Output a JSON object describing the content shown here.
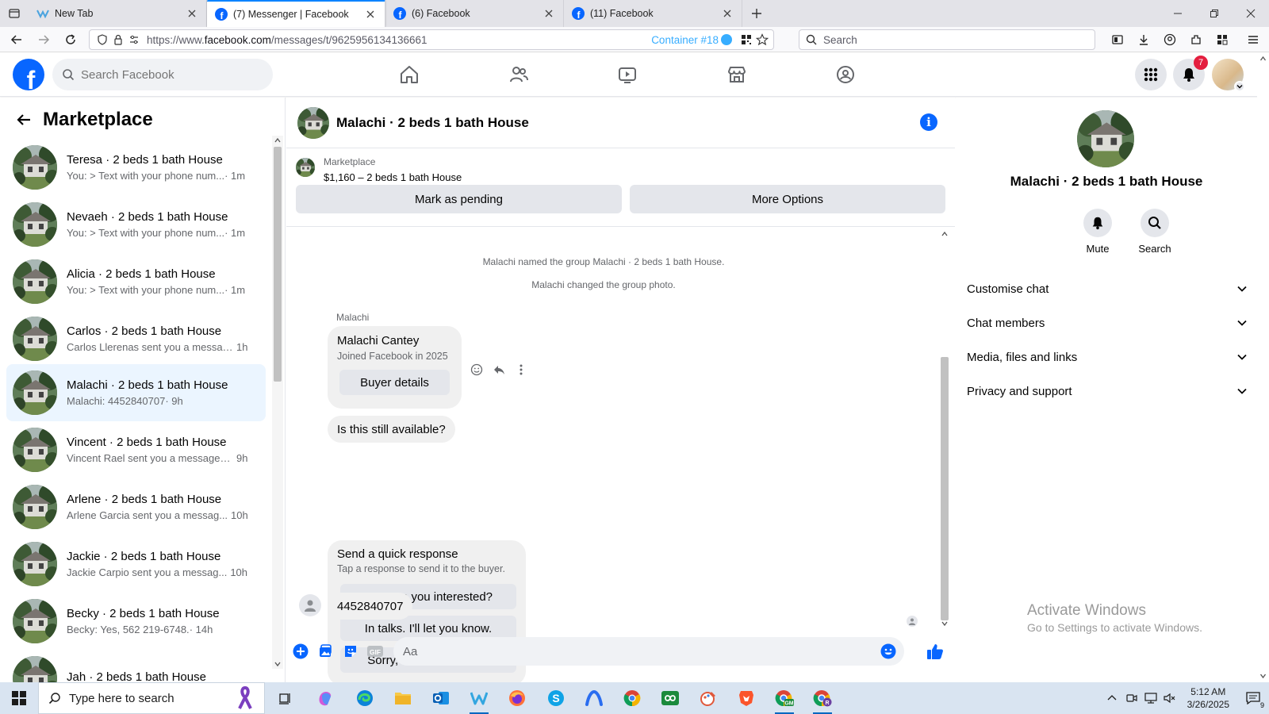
{
  "browser": {
    "tabs": [
      {
        "title": "New Tab",
        "active": false,
        "favicon": "new-tab-icon"
      },
      {
        "title": "(7) Messenger | Facebook",
        "active": true,
        "favicon": "facebook-icon"
      },
      {
        "title": "(6) Facebook",
        "active": false,
        "favicon": "facebook-icon"
      },
      {
        "title": "(11) Facebook",
        "active": false,
        "favicon": "facebook-icon"
      }
    ],
    "url_prefix": "https://www.",
    "url_domain": "facebook.com",
    "url_path": "/messages/t/9625956134136661",
    "container_label": "Container #18",
    "search_placeholder": "Search"
  },
  "fb": {
    "logo_letter": "f",
    "search_placeholder": "Search Facebook",
    "notification_count": "7",
    "nav_icons": [
      "home-icon",
      "friends-icon",
      "watch-icon",
      "marketplace-icon",
      "groups-icon"
    ]
  },
  "sidebar": {
    "title": "Marketplace",
    "conversations": [
      {
        "name": "Teresa · 2 beds 1 bath House",
        "preview": "You: > Text with your phone num...",
        "time": "· 1m",
        "active": false
      },
      {
        "name": "Nevaeh · 2 beds 1 bath House",
        "preview": "You: > Text with your phone num...",
        "time": "· 1m",
        "active": false
      },
      {
        "name": "Alicia · 2 beds 1 bath House",
        "preview": "You: > Text with your phone num...",
        "time": "· 1m",
        "active": false
      },
      {
        "name": "Carlos · 2 beds 1 bath House",
        "preview": "Carlos Llerenas sent you a messag...",
        "time": "1h",
        "active": false
      },
      {
        "name": "Malachi · 2 beds 1 bath House",
        "preview": "Malachi: 4452840707",
        "time": "· 9h",
        "active": true
      },
      {
        "name": "Vincent · 2 beds 1 bath House",
        "preview": "Vincent Rael sent you a message a...",
        "time": "9h",
        "active": false
      },
      {
        "name": "Arlene · 2 beds 1 bath House",
        "preview": "Arlene Garcia sent you a messag...",
        "time": "10h",
        "active": false
      },
      {
        "name": "Jackie · 2 beds 1 bath House",
        "preview": "Jackie Carpio sent you a messag...",
        "time": "10h",
        "active": false
      },
      {
        "name": "Becky · 2 beds 1 bath House",
        "preview": "Becky: Yes, 562 219-6748.",
        "time": "· 14h",
        "active": false
      },
      {
        "name": "Jah · 2 beds 1 bath House",
        "preview": "",
        "time": "",
        "active": false
      }
    ]
  },
  "chat": {
    "title": "Malachi · 2 beds 1 bath House",
    "listing_label": "Marketplace",
    "listing_price": "$1,160 – 2 beds 1 bath House",
    "mark_pending": "Mark as pending",
    "more_options": "More Options",
    "system_messages": [
      "Malachi named the group Malachi · 2 beds 1 bath House.",
      "Malachi changed the group photo."
    ],
    "sender": "Malachi",
    "buyer_name": "Malachi Cantey",
    "buyer_joined": "Joined Facebook in 2025",
    "buyer_details": "Buyer details",
    "question": "Is this still available?",
    "quick_title": "Send a quick response",
    "quick_sub": "Tap a response to send it to the buyer.",
    "quick_responses": [
      "Yes. Are you interested?",
      "In talks. I'll let you know.",
      "Sorry, it's not available."
    ],
    "last_message": "4452840707",
    "composer_placeholder": "Aa"
  },
  "info_panel": {
    "name": "Malachi · 2 beds 1 bath House",
    "mute": "Mute",
    "search": "Search",
    "sections": [
      "Customise chat",
      "Chat members",
      "Media, files and links",
      "Privacy and support"
    ],
    "watermark_title": "Activate Windows",
    "watermark_sub": "Go to Settings to activate Windows."
  },
  "taskbar": {
    "search_placeholder": "Type here to search",
    "time": "5:12 AM",
    "date": "3/26/2025",
    "notification_count": "9"
  },
  "colors": {
    "fb_blue": "#0866ff",
    "active_convo": "#ebf5ff",
    "container_blue": "#37adff"
  }
}
